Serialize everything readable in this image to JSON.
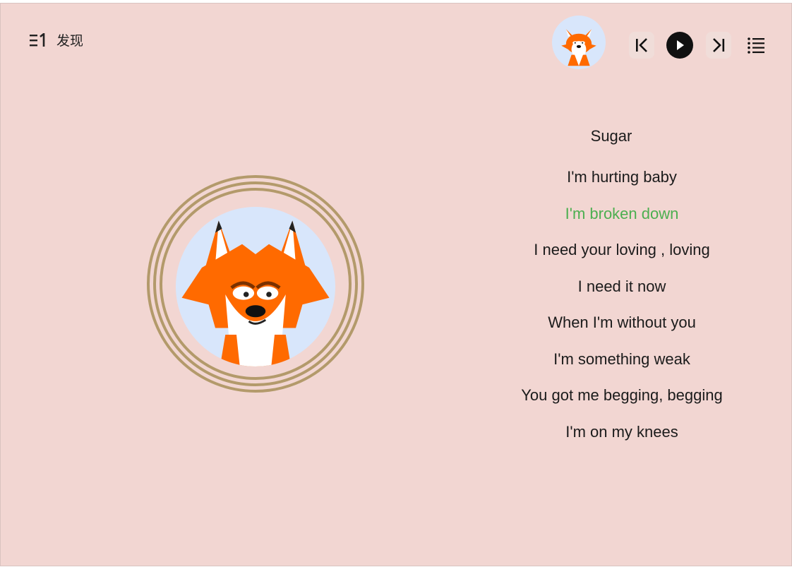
{
  "nav": {
    "menu_icon": "playlist-one-icon",
    "discover_label": "发现"
  },
  "player": {
    "cover_icon": "fox-avatar",
    "controls": {
      "prev_icon": "skip-previous-icon",
      "play_icon": "play-icon",
      "next_icon": "skip-next-icon",
      "list_icon": "list-icon"
    }
  },
  "song": {
    "title": "Sugar",
    "lyrics": [
      {
        "text": "I'm hurting baby",
        "active": false
      },
      {
        "text": "I'm broken down",
        "active": true
      },
      {
        "text": "I need your loving , loving",
        "active": false
      },
      {
        "text": "I need it now",
        "active": false
      },
      {
        "text": "When I'm without you",
        "active": false
      },
      {
        "text": "I'm something weak",
        "active": false
      },
      {
        "text": "You got me begging, begging",
        "active": false
      },
      {
        "text": "I'm on my knees",
        "active": false
      }
    ]
  },
  "colors": {
    "background": "#f2d6d2",
    "active_lyric": "#4caf50",
    "cover_bg": "#d8e6fb",
    "ring": "#b39a6b"
  }
}
